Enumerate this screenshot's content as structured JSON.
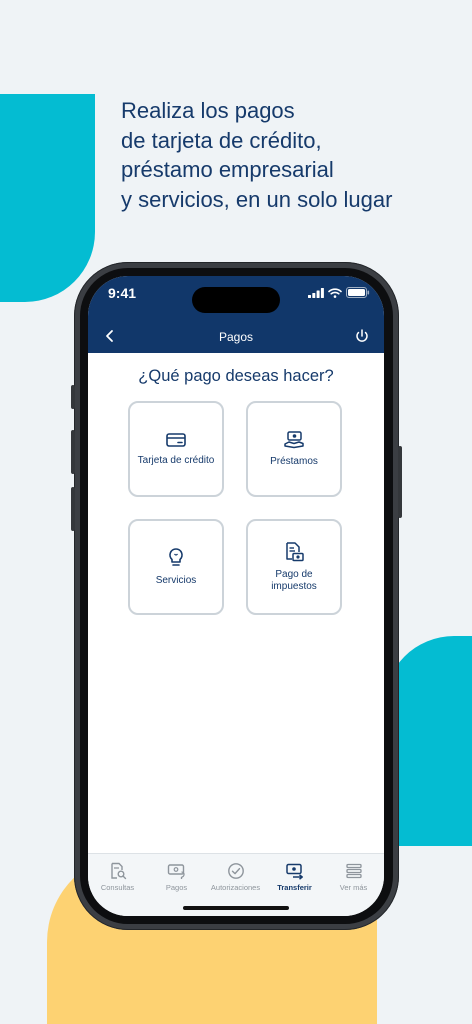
{
  "headline": {
    "line1": "Realiza los pagos",
    "line2": "de tarjeta de crédito,",
    "line3": "préstamo empresarial",
    "line4": "y servicios, en un solo lugar"
  },
  "status": {
    "time": "9:41"
  },
  "appbar": {
    "title": "Pagos"
  },
  "main": {
    "question": "¿Qué pago deseas hacer?",
    "options": [
      {
        "label": "Tarjeta de crédito",
        "icon": "credit-card-icon"
      },
      {
        "label": "Préstamos",
        "icon": "loan-icon"
      },
      {
        "label": "Servicios",
        "icon": "lightbulb-icon"
      },
      {
        "label": "Pago de impuestos",
        "icon": "tax-document-icon"
      }
    ]
  },
  "tabbar": {
    "items": [
      {
        "label": "Consultas",
        "icon": "document-search-icon"
      },
      {
        "label": "Pagos",
        "icon": "payments-icon"
      },
      {
        "label": "Autorizaciones",
        "icon": "check-circle-icon"
      },
      {
        "label": "Transferir",
        "icon": "transfer-icon",
        "active": true
      },
      {
        "label": "Ver más",
        "icon": "menu-icon"
      }
    ]
  },
  "colors": {
    "navy": "#11376a",
    "teal": "#04bcd2",
    "yellow": "#fdd272",
    "background": "#eff3f6"
  }
}
